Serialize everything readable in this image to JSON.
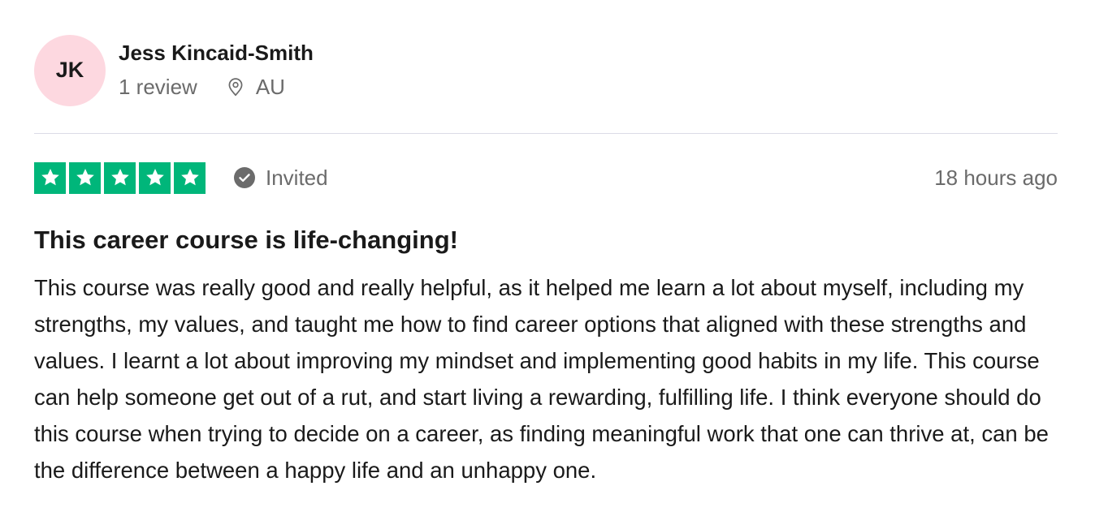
{
  "consumer": {
    "initials": "JK",
    "name": "Jess Kincaid-Smith",
    "review_count": "1 review",
    "location": "AU",
    "avatar_color": "#fdd8e0"
  },
  "review": {
    "rating": 5,
    "star_color": "#00b67a",
    "verification": "Invited",
    "verification_icon": "check-circle-icon",
    "timestamp": "18 hours ago",
    "title": "This career course is life-changing!",
    "body": "This course was really good and really helpful, as it helped me learn a lot about myself, including my strengths, my values, and taught me how to find career options that aligned with these strengths and values. I learnt a lot about improving my mindset and implementing good habits in my life. This course can help someone get out of a rut, and start living a rewarding, fulfilling life. I think everyone should do this course when trying to decide on a career, as finding meaningful work that one can thrive at, can be the difference between a happy life and an unhappy one."
  }
}
